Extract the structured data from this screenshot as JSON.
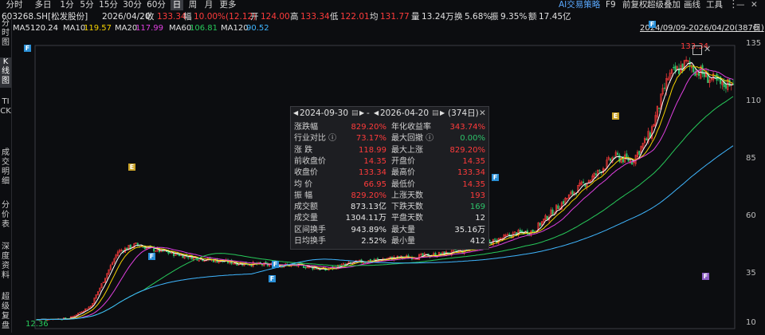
{
  "toolbar": {
    "periods": [
      "分时",
      "多日",
      "1分",
      "5分",
      "15分",
      "30分",
      "60分",
      "日",
      "周",
      "月",
      "更多"
    ],
    "active_period": "日",
    "right_tools": [
      "AI交易策略",
      "F9",
      "前复权",
      "超级叠加",
      "画线",
      "工具"
    ]
  },
  "sidebar": {
    "tabs": [
      "分时图",
      "K线图",
      "TICK",
      "成交明细",
      "分价表",
      "深度资料",
      "超级复盘"
    ],
    "active_tab": "K线图"
  },
  "quote": {
    "code": "603268.SH[松发股份]",
    "date": "2026/04/20",
    "close_label": "收",
    "close": "133.34",
    "change_label": "幅",
    "change": "10.00%(12.12)",
    "open_label": "开",
    "open": "124.00",
    "high_label": "高",
    "high": "133.34",
    "low_label": "低",
    "low": "122.01",
    "avg_label": "均",
    "avg": "131.77",
    "volume_label": "量",
    "volume": "13.24万",
    "turnover_label": "换",
    "turnover": "5.68%",
    "amplitude_label": "振",
    "amplitude": "9.35%",
    "amount_label": "额",
    "amount": "17.45亿"
  },
  "ma": [
    {
      "label": "MA5",
      "value": "120.24",
      "color": "#ffffff"
    },
    {
      "label": "MA10",
      "value": "119.57",
      "color": "#f5d200"
    },
    {
      "label": "MA20",
      "value": "117.99",
      "color": "#e040e0"
    },
    {
      "label": "MA60",
      "value": "106.81",
      "color": "#27c95a"
    },
    {
      "label": "MA120",
      "value": "90.52",
      "color": "#3fb6ff"
    }
  ],
  "range_label": "2024/09/09-2026/04/20(387日)",
  "price_axis": [
    "135",
    "110",
    "85",
    "60",
    "35",
    "10"
  ],
  "chart_labels": {
    "high_tag": "133.34",
    "low_tag": "12.36"
  },
  "markers": [
    "F",
    "F",
    "E",
    "F",
    "F",
    "E",
    "F",
    "F"
  ],
  "popup": {
    "start_date": "2024-09-30",
    "end_date": "2026-04-20",
    "days": "(374日)",
    "rows": [
      {
        "l1": "涨跌幅",
        "v1": "829.20%",
        "c1": "red",
        "l2": "年化收益率",
        "v2": "343.74%",
        "c2": "red"
      },
      {
        "l1": "行业对比 ⓘ",
        "v1": "73.17%",
        "c1": "red",
        "l2": "最大回撤 ⓘ",
        "v2": "0.00%",
        "c2": "green"
      },
      {
        "l1": "涨 跌",
        "v1": "118.99",
        "c1": "red",
        "l2": "最大上涨",
        "v2": "829.20%",
        "c2": "red"
      },
      {
        "l1": "前收盘价",
        "v1": "14.35",
        "c1": "red",
        "l2": "开盘价",
        "v2": "14.35",
        "c2": "red"
      },
      {
        "l1": "收盘价",
        "v1": "133.34",
        "c1": "red",
        "l2": "最高价",
        "v2": "133.34",
        "c2": "red"
      },
      {
        "l1": "均 价",
        "v1": "66.95",
        "c1": "red",
        "l2": "最低价",
        "v2": "14.35",
        "c2": "red"
      },
      {
        "l1": "振 幅",
        "v1": "829.20%",
        "c1": "red",
        "l2": "上涨天数",
        "v2": "193",
        "c2": "red"
      },
      {
        "l1": "成交额",
        "v1": "873.13亿",
        "c1": "white",
        "l2": "下跌天数",
        "v2": "169",
        "c2": "green"
      },
      {
        "l1": "成交量",
        "v1": "1304.11万",
        "c1": "white",
        "l2": "平盘天数",
        "v2": "12",
        "c2": "white"
      },
      {
        "l1": "区间换手",
        "v1": "943.89%",
        "c1": "white",
        "l2": "最大量",
        "v2": "35.16万",
        "c2": "white"
      },
      {
        "l1": "日均换手",
        "v1": "2.52%",
        "c1": "white",
        "l2": "最小量",
        "v2": "412",
        "c2": "white"
      }
    ]
  }
}
